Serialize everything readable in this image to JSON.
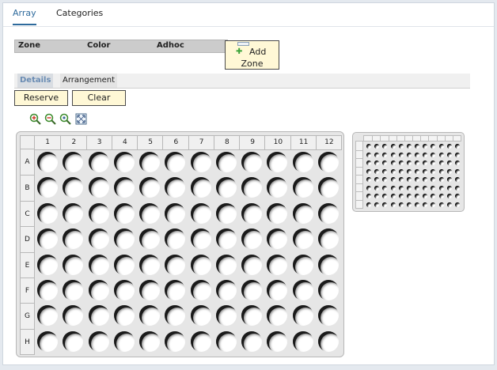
{
  "tabs": [
    {
      "label": "Array",
      "active": true
    },
    {
      "label": "Categories",
      "active": false
    }
  ],
  "zone_table": {
    "columns": [
      "Zone",
      "Color",
      "Adhoc"
    ],
    "add_button": {
      "line1": "Add",
      "line2": "Zone",
      "icon": "plus-icon"
    }
  },
  "subtabs": [
    {
      "label": "Details",
      "active": true
    },
    {
      "label": "Arrangement",
      "active": false
    }
  ],
  "actions": {
    "reserve_label": "Reserve",
    "clear_label": "Clear"
  },
  "zoom_tools": [
    "zoom-in-icon",
    "zoom-out-icon",
    "zoom-actual-icon",
    "fit-to-screen-icon"
  ],
  "plate": {
    "columns": [
      "1",
      "2",
      "3",
      "4",
      "5",
      "6",
      "7",
      "8",
      "9",
      "10",
      "11",
      "12"
    ],
    "rows": [
      "A",
      "B",
      "C",
      "D",
      "E",
      "F",
      "G",
      "H"
    ]
  },
  "minimap": {
    "column_count": 12,
    "row_count": 8
  },
  "colors": {
    "accent": "#2e6a9c",
    "button_fill": "#fff8d6",
    "plate_bg": "#e6e6e6",
    "header_bg": "#cccccc"
  }
}
